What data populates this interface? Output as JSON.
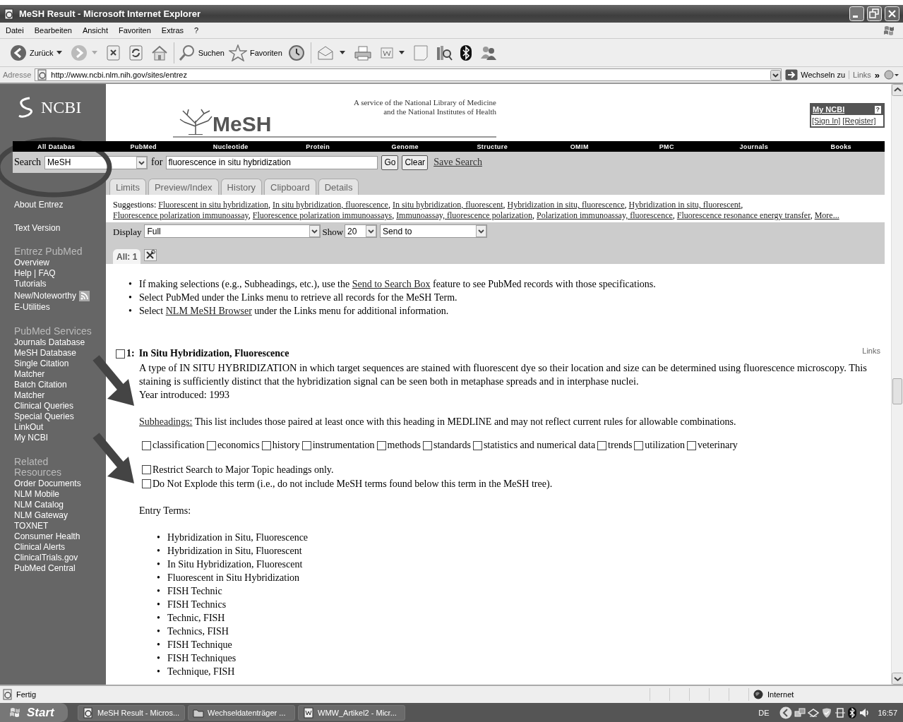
{
  "window": {
    "title": "MeSH Result - Microsoft Internet Explorer"
  },
  "menu": [
    "Datei",
    "Bearbeiten",
    "Ansicht",
    "Favoriten",
    "Extras",
    "?"
  ],
  "toolbar": {
    "back": "Zurück",
    "search": "Suchen",
    "favorites": "Favoriten"
  },
  "address": {
    "label": "Adresse",
    "value": "http://www.ncbi.nlm.nih.gov/sites/entrez",
    "go": "Wechseln zu",
    "links": "Links",
    "more": "»"
  },
  "sidebar": {
    "logo": "NCBI",
    "links": [
      "About Entrez",
      "Text Version"
    ],
    "sections": [
      {
        "title": "Entrez PubMed",
        "items": [
          {
            "label": "Overview",
            "kind": "link"
          },
          {
            "label": "Help | FAQ",
            "kind": "link"
          },
          {
            "label": "Tutorials",
            "kind": "link"
          },
          {
            "label": "New/Noteworthy",
            "kind": "feed"
          },
          {
            "label": "E-Utilities",
            "kind": "link"
          }
        ]
      },
      {
        "title": "PubMed Services",
        "items": [
          {
            "label": "Journals Database",
            "kind": "link"
          },
          {
            "label": "MeSH Database",
            "kind": "link"
          },
          {
            "label": "Single Citation Matcher",
            "kind": "link"
          },
          {
            "label": "Batch Citation Matcher",
            "kind": "link"
          },
          {
            "label": "Clinical Queries",
            "kind": "link"
          },
          {
            "label": "Special Queries",
            "kind": "link"
          },
          {
            "label": "LinkOut",
            "kind": "link"
          },
          {
            "label": "My NCBI",
            "kind": "link"
          }
        ]
      },
      {
        "title": "Related Resources",
        "items": [
          {
            "label": "Order Documents",
            "kind": "link"
          },
          {
            "label": "NLM Mobile",
            "kind": "link"
          },
          {
            "label": "NLM Catalog",
            "kind": "link"
          },
          {
            "label": "NLM Gateway",
            "kind": "link"
          },
          {
            "label": "TOXNET",
            "kind": "link"
          },
          {
            "label": "Consumer Health",
            "kind": "link"
          },
          {
            "label": "Clinical Alerts",
            "kind": "link"
          },
          {
            "label": "ClinicalTrials.gov",
            "kind": "link"
          },
          {
            "label": "PubMed Central",
            "kind": "link"
          }
        ]
      }
    ]
  },
  "header": {
    "logo": "MeSH",
    "service": [
      "A service of the National Library of Medicine",
      "and the National Institutes of Health"
    ],
    "my_ncbi": {
      "title": "My NCBI",
      "help": "?",
      "sign_in": "[Sign In]",
      "register": "[Register]"
    }
  },
  "databases": [
    "All Databas",
    "PubMed",
    "Nucleotide",
    "Protein",
    "Genome",
    "Structure",
    "OMIM",
    "PMC",
    "Journals",
    "Books"
  ],
  "search": {
    "label": "Search",
    "db": "MeSH",
    "for": "for",
    "query": "fluorescence in situ hybridization",
    "go": "Go",
    "clear": "Clear",
    "save": "Save Search"
  },
  "tabs": [
    "Limits",
    "Preview/Index",
    "History",
    "Clipboard",
    "Details"
  ],
  "suggestions": {
    "label": "Suggestions:",
    "links": [
      "Fluorescent in situ hybridization",
      "In situ hybridization, fluorescence",
      "In situ hybridization, fluorescent",
      "Hybridization in situ, fluorescence",
      "Hybridization in situ, fluorescent",
      "Fluorescence polarization immunoassay",
      "Fluorescence polarization immunoassays",
      "Immunoassay, fluorescence polarization",
      "Polarization immunoassay, fluorescence",
      "Fluorescence resonance energy transfer"
    ],
    "more": "More...",
    "separator": ","
  },
  "display": {
    "label": "Display",
    "format": "Full",
    "show_label": "Show",
    "count": "20",
    "send": "Send to"
  },
  "result_tab": "All: 1",
  "bullet": "•",
  "notes": [
    {
      "before": "If making selections (e.g., Subheadings, etc.), use the ",
      "link": "Send to Search Box",
      "after": " feature to see PubMed records with those specifications."
    },
    {
      "before": "Select PubMed under the Links menu to retrieve all records for the MeSH Term."
    },
    {
      "before": "Select ",
      "link": "NLM MeSH Browser",
      "after": " under the Links menu for additional information."
    }
  ],
  "record": {
    "checked": false,
    "number": "1:",
    "title": "In Situ Hybridization, Fluorescence",
    "links": "Links",
    "description": "A type of IN SITU HYBRIDIZATION in which target sequences are stained with fluorescent dye so their location and size can be determined using fluorescence microscopy. This staining is sufficiently distinct that the hybridization signal can be seen both in metaphase spreads and in interphase nuclei.",
    "year": "Year introduced: 1993",
    "subheadings_link": "Subheadings:",
    "subheadings_text": "This list includes those paired at least once with this heading in MEDLINE and may not reflect current rules for allowable combinations.",
    "subheadings": [
      {
        "label": "classification",
        "checked": false
      },
      {
        "label": "economics",
        "checked": false
      },
      {
        "label": "history",
        "checked": false
      },
      {
        "label": "instrumentation",
        "checked": false
      },
      {
        "label": "methods",
        "checked": false
      },
      {
        "label": "standards",
        "checked": false
      },
      {
        "label": "statistics and numerical data",
        "checked": false
      },
      {
        "label": "trends",
        "checked": false
      },
      {
        "label": "utilization",
        "checked": false
      },
      {
        "label": "veterinary",
        "checked": false
      }
    ],
    "options": [
      {
        "label": "Restrict Search to Major Topic headings only.",
        "checked": false
      },
      {
        "label": "Do Not Explode this term (i.e., do not include MeSH terms found below this term in the MeSH tree).",
        "checked": false
      }
    ],
    "entry_terms_title": "Entry Terms:",
    "entry_terms": [
      "Hybridization in Situ, Fluorescence",
      "Hybridization in Situ, Fluorescent",
      "In Situ Hybridization, Fluorescent",
      "Fluorescent in Situ Hybridization",
      "FISH Technic",
      "FISH Technics",
      "Technic, FISH",
      "Technics, FISH",
      "FISH Technique",
      "FISH Techniques",
      "Technique, FISH"
    ]
  },
  "status_bar": {
    "text": "Fertig",
    "zone": "Internet"
  },
  "taskbar": {
    "start": "Start",
    "tasks": [
      "MeSH Result - Micros...",
      "Wechseldatenträger ...",
      "WMW_Artikel2 - Micr..."
    ],
    "language": "DE",
    "time": "16:57"
  }
}
